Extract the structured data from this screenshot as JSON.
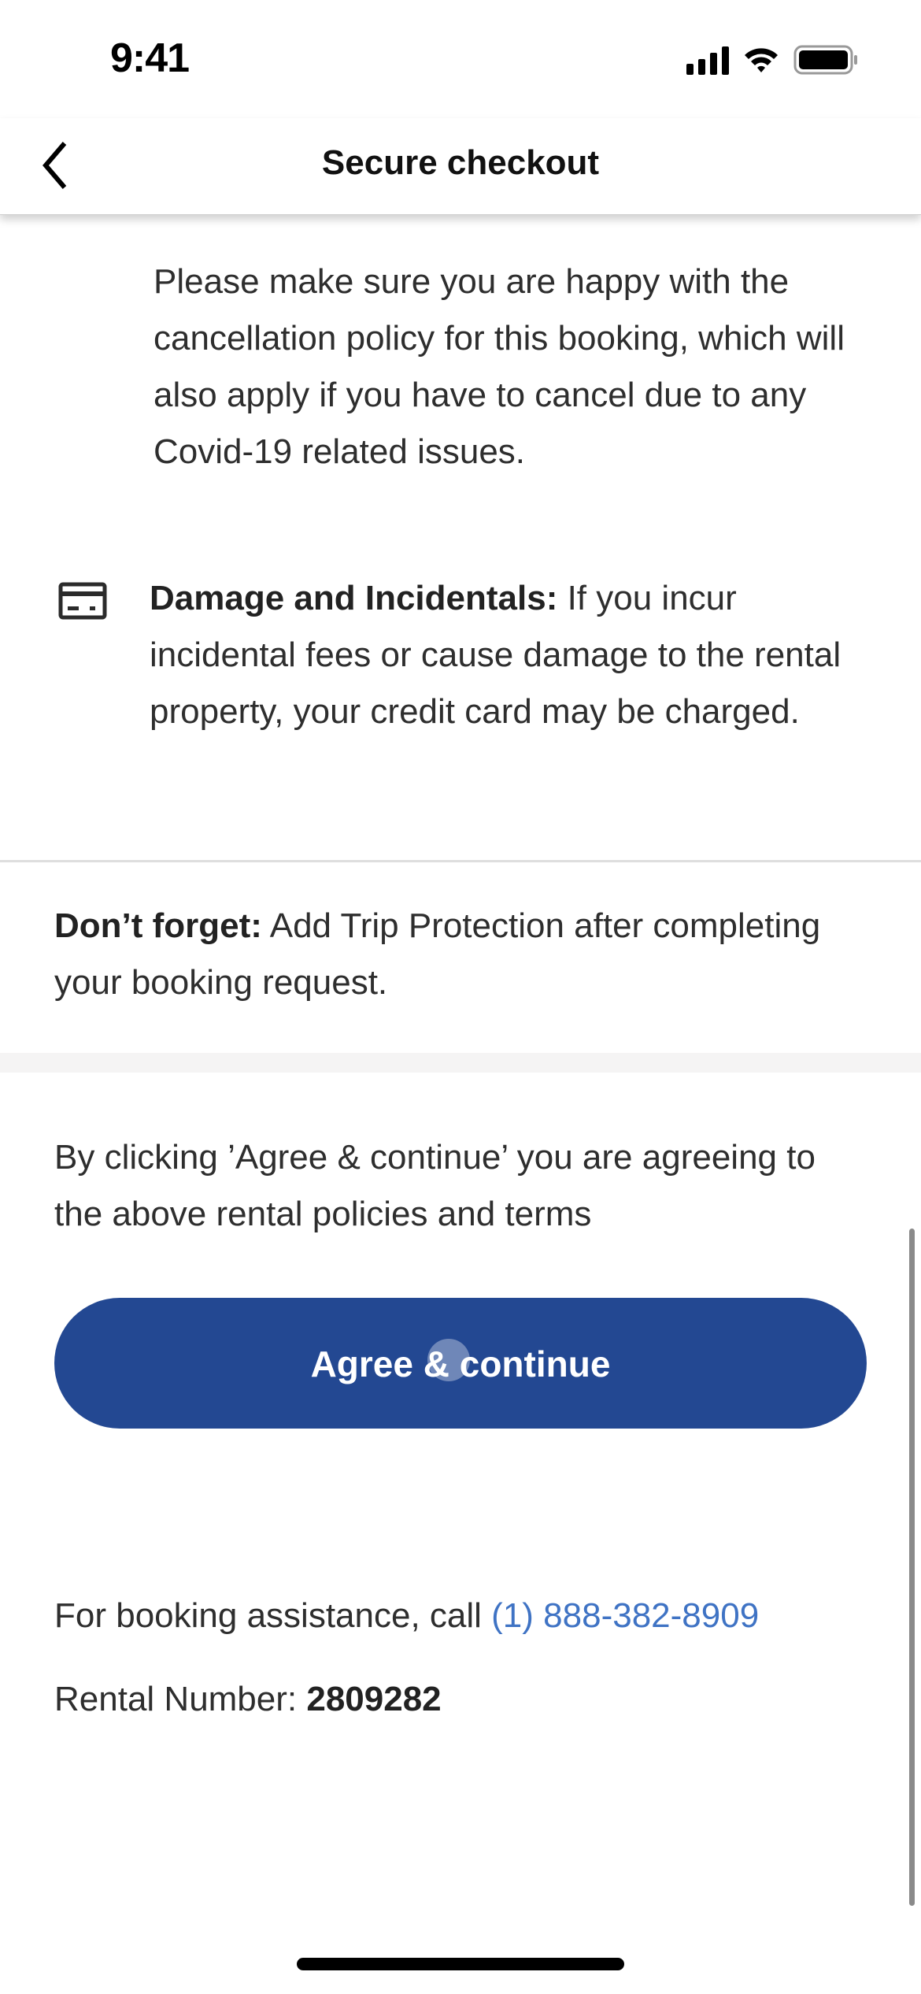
{
  "status_bar": {
    "time": "9:41",
    "icons": [
      "cellular-signal-icon",
      "wifi-icon",
      "battery-icon"
    ]
  },
  "nav": {
    "title": "Secure checkout",
    "back_icon": "chevron-left-icon"
  },
  "policies": {
    "cancellation_text": "Please make sure you are happy with the cancellation policy for this booking, which will also apply if you have to cancel due to any Covid-19 related issues.",
    "damage": {
      "icon": "credit-card-icon",
      "label": "Damage and Incidentals:",
      "text": " If you incur incidental fees or cause damage to the rental property, your credit card may be charged."
    }
  },
  "reminder": {
    "label": "Don’t forget:",
    "text": " Add Trip Protection after completing your booking request."
  },
  "agreement": {
    "text": "By clicking ’Agree & continue’ you are agreeing to the above rental policies and terms",
    "button_label": "Agree & continue",
    "button_color": "#234892"
  },
  "footer": {
    "assist_text": "For booking assistance, call ",
    "phone": "(1) 888-382-8909",
    "phone_color": "#3f73c4",
    "rental_label": "Rental Number: ",
    "rental_number": "2809282"
  }
}
